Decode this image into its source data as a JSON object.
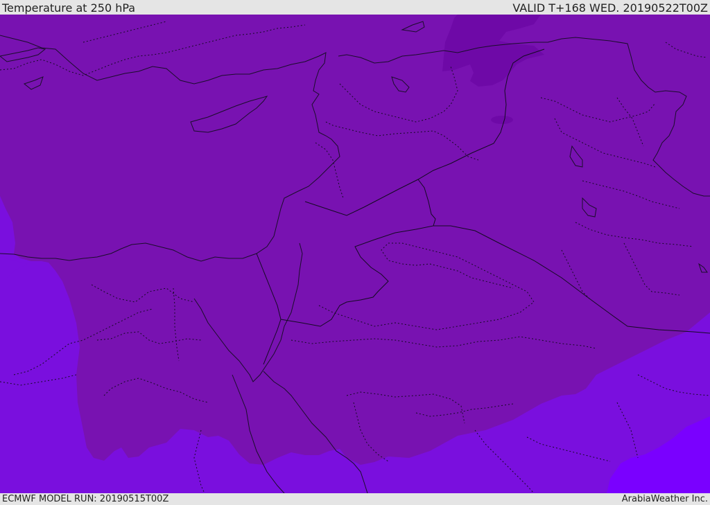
{
  "header": {
    "title": "Temperature at 250 hPa",
    "valid": "VALID T+168 WED. 20190522T00Z"
  },
  "footer": {
    "model_run": "ECMWF MODEL RUN: 20190515T00Z",
    "credit": "ArabiaWeather Inc."
  },
  "map": {
    "colors": {
      "base": "#7812b1",
      "warm": "#7a0fde",
      "warmest": "#7a00ff",
      "cold": "#6e09a7",
      "coast_line": "#1a0d2a",
      "border_line": "#140a22"
    }
  }
}
